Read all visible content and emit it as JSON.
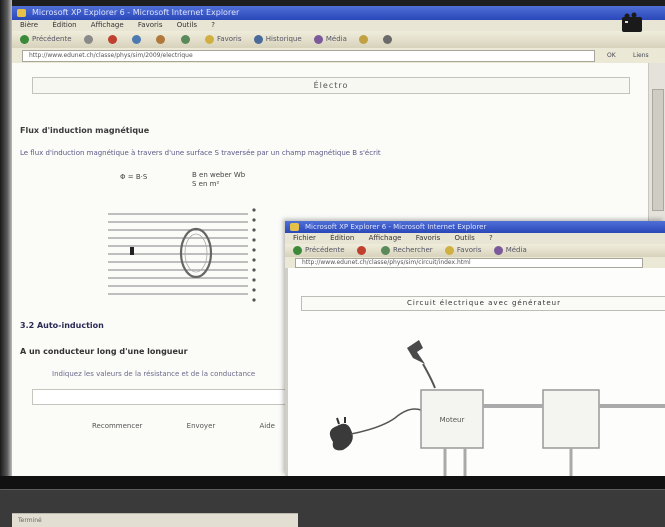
{
  "window1": {
    "title": "Microsoft XP Explorer 6 - Microsoft Internet Explorer",
    "menu": [
      "Bière",
      "Édition",
      "Affichage",
      "Favoris",
      "Outils",
      "?"
    ],
    "toolbar": [
      "Précédente",
      "Favoris",
      "Historique",
      "Média"
    ],
    "address_value": "http://www.edunet.ch/classe/phys/sim/2009/electrique",
    "go_label": "OK",
    "links_label": "Liens",
    "header": "Électro",
    "heading": "Flux d'induction magnétique",
    "paragraph": "Le flux d'induction magnétique à travers d'une surface S traversée par un champ magnétique B s'écrit",
    "formula_left": "Φ = B·S",
    "formula_right": [
      "B en weber Wb",
      "S en m²"
    ],
    "section_title": "3.2 Auto-induction",
    "subsection": "A un conducteur long d'une longueur",
    "paragraph2": "Indiquez les valeurs de la résistance et de la conductance",
    "buttons": [
      "Recommencer",
      "Envoyer",
      "Aide"
    ],
    "status": "Terminé"
  },
  "window2": {
    "title": "Microsoft XP Explorer 6 - Microsoft Internet Explorer",
    "menu": [
      "Fichier",
      "Édition",
      "Affichage",
      "Favoris",
      "Outils",
      "?"
    ],
    "toolbar": [
      "Précédente",
      "Rechercher",
      "Favoris",
      "Média"
    ],
    "address_value": "http://www.edunet.ch/classe/phys/sim/circuit/index.html",
    "header": "Circuit électrique avec générateur",
    "diagram_label": "Moteur"
  },
  "colors": {
    "title_bar": "#2a47b8",
    "menu_bg": "#e9e5d4",
    "content_bg": "#fbfbf8",
    "heading_link": "#2a2a55"
  },
  "icons": [
    "back-icon",
    "forward-icon",
    "stop-icon",
    "refresh-icon",
    "home-icon",
    "search-icon",
    "favorites-icon",
    "history-icon",
    "mail-icon",
    "print-icon",
    "film-icon",
    "plug-icon",
    "bulb-icon"
  ]
}
